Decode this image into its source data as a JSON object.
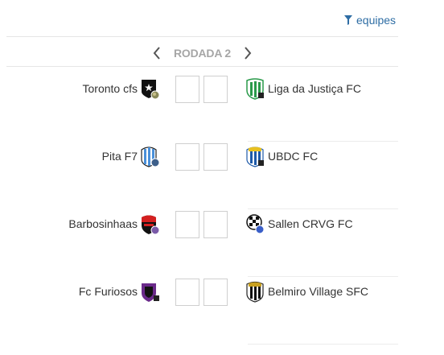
{
  "filter": {
    "label": "equipes",
    "icon": "filter-icon",
    "color": "#2e6da4"
  },
  "round": {
    "label": "RODADA 2",
    "prev_icon": "chevron-left-icon",
    "next_icon": "chevron-right-icon"
  },
  "matches": [
    {
      "home": {
        "name": "Toronto cfs",
        "crest": "star-shield-crest"
      },
      "away": {
        "name": "Liga da Justiça FC",
        "crest": "green-stripes-crest"
      },
      "home_score": "",
      "away_score": ""
    },
    {
      "home": {
        "name": "Pita F7",
        "crest": "blue-stripes-crest"
      },
      "away": {
        "name": "UBDC FC",
        "crest": "blue-stripes-crest"
      },
      "home_score": "",
      "away_score": ""
    },
    {
      "home": {
        "name": "Barbosinhaas",
        "crest": "red-black-crest"
      },
      "away": {
        "name": "Sallen CRVG FC",
        "crest": "checkered-crest"
      },
      "home_score": "",
      "away_score": ""
    },
    {
      "home": {
        "name": "Fc Furiosos",
        "crest": "purple-black-crest"
      },
      "away": {
        "name": "Belmiro Village SFC",
        "crest": "black-white-stripes-crest"
      },
      "home_score": "",
      "away_score": ""
    }
  ]
}
